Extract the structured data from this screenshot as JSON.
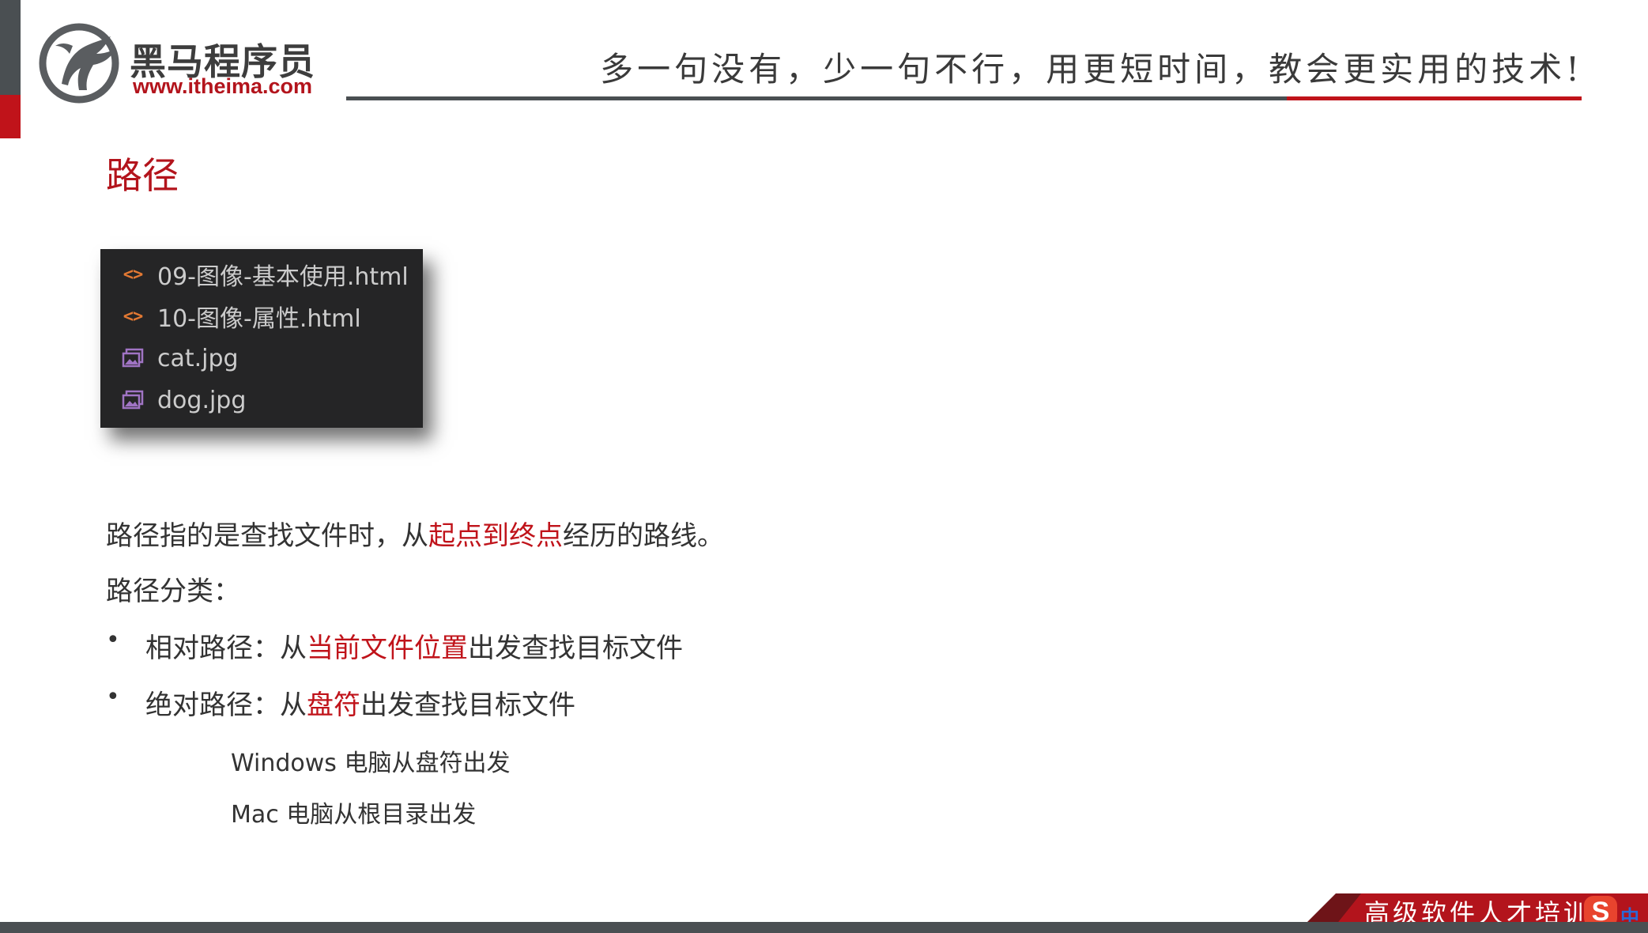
{
  "header": {
    "logo_text": "黑马程序员",
    "logo_url": "www.itheima.com",
    "slogan": "多一句没有，少一句不行，用更短时间，教会更实用的技术!"
  },
  "page": {
    "title": "路径"
  },
  "explorer": {
    "files": [
      {
        "name": "09-图像-基本使用.html",
        "icon": "html-code-icon"
      },
      {
        "name": "10-图像-属性.html",
        "icon": "html-code-icon"
      },
      {
        "name": "cat.jpg",
        "icon": "image-file-icon"
      },
      {
        "name": "dog.jpg",
        "icon": "image-file-icon"
      }
    ]
  },
  "content": {
    "definition": {
      "before": "路径指的是查找文件时，从",
      "highlight": "起点到终点",
      "after": "经历的路线。"
    },
    "category_heading": "路径分类：",
    "bullets": [
      {
        "marker": "•",
        "before": "相对路径：从",
        "highlight": "当前文件位置",
        "after": "出发查找目标文件"
      },
      {
        "marker": "•",
        "before": "绝对路径：从",
        "highlight": "盘符",
        "after": "出发查找目标文件"
      }
    ],
    "notes": [
      "Windows 电脑从盘符出发",
      "Mac 电脑从根目录出发"
    ]
  },
  "footer": {
    "tagline": "高级软件人才培训",
    "ime_logo": "S",
    "ime_mode": "中"
  },
  "colors": {
    "accent_red": "#c0131a",
    "dark_gray": "#4a4f52",
    "explorer_bg": "#252526",
    "html_icon": "#e37933",
    "image_icon": "#a074c4"
  }
}
